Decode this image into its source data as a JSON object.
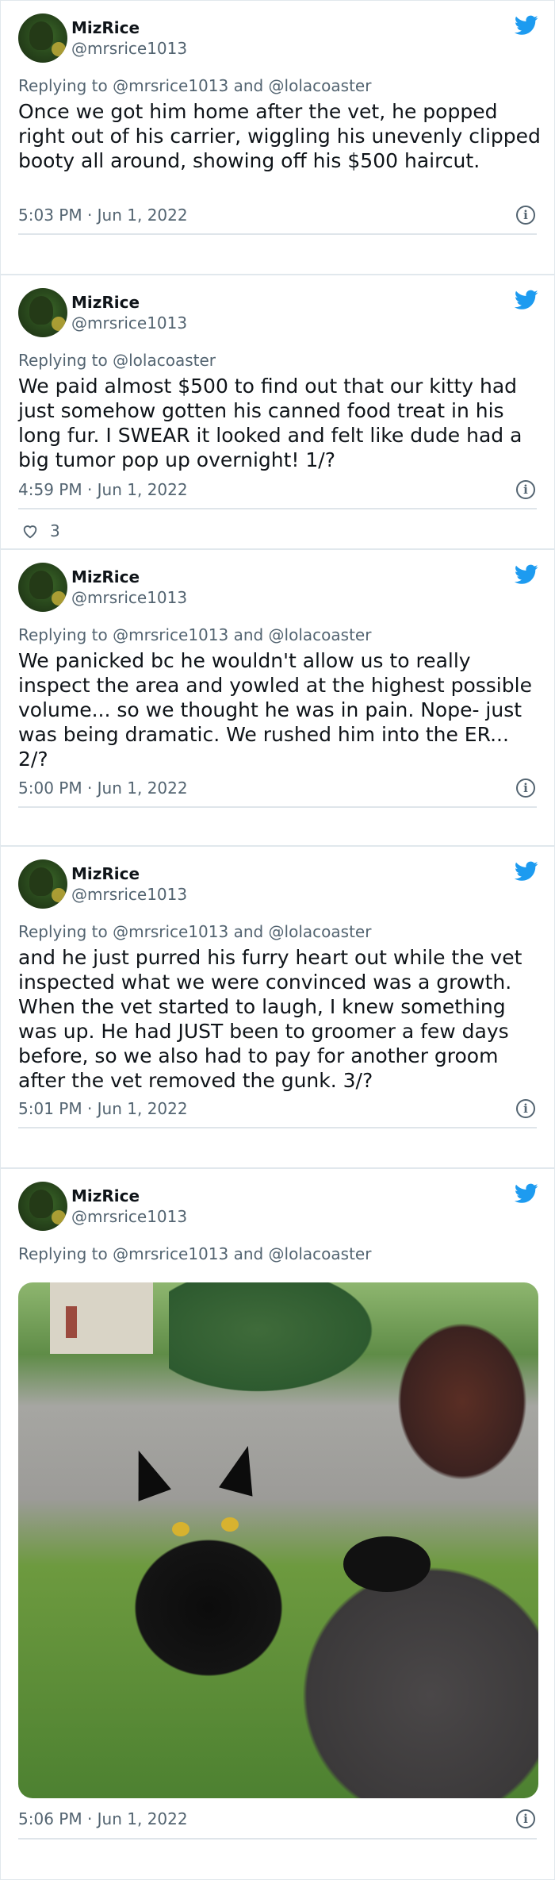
{
  "tweets": [
    {
      "name": "MizRice",
      "handle": "@mrsrice1013",
      "reply": "Replying to @mrsrice1013 and @lolacoaster",
      "text": "Once we got him home after the vet, he popped right out of his carrier, wiggling his unevenly clipped booty all around, showing off his $500 haircut.",
      "time": "5:03 PM · Jun 1, 2022"
    },
    {
      "name": "MizRice",
      "handle": "@mrsrice1013",
      "reply": "Replying to @lolacoaster",
      "text": "We paid almost $500 to find out that our kitty had just somehow gotten his canned food treat in his long fur. I SWEAR it looked and felt like dude had a big tumor pop up overnight! 1/?",
      "time": "4:59 PM · Jun 1, 2022",
      "likes": "3"
    },
    {
      "name": "MizRice",
      "handle": "@mrsrice1013",
      "reply": "Replying to @mrsrice1013 and @lolacoaster",
      "text": "We panicked bc he wouldn't allow us to really inspect the area and yowled at the highest possible volume... so we thought he was in pain. Nope- just was being dramatic. We rushed him into the ER... 2/?",
      "time": "5:00 PM · Jun 1, 2022"
    },
    {
      "name": "MizRice",
      "handle": "@mrsrice1013",
      "reply": "Replying to @mrsrice1013 and @lolacoaster",
      "text": "and he just purred his furry heart out while the vet inspected what we were convinced was a growth. When the vet started to laugh, I knew something was up. He had JUST been to groomer a few days before, so we also had to pay for another groom after the vet removed the gunk. 3/?",
      "time": "5:01 PM · Jun 1, 2022"
    },
    {
      "name": "MizRice",
      "handle": "@mrsrice1013",
      "reply": "Replying to @mrsrice1013 and @lolacoaster",
      "time": "5:06 PM · Jun 1, 2022"
    }
  ],
  "icons": {
    "brand": "twitter-bird-icon",
    "info": "info-icon",
    "like": "heart-icon",
    "brand_color": "#1d9bf0"
  }
}
